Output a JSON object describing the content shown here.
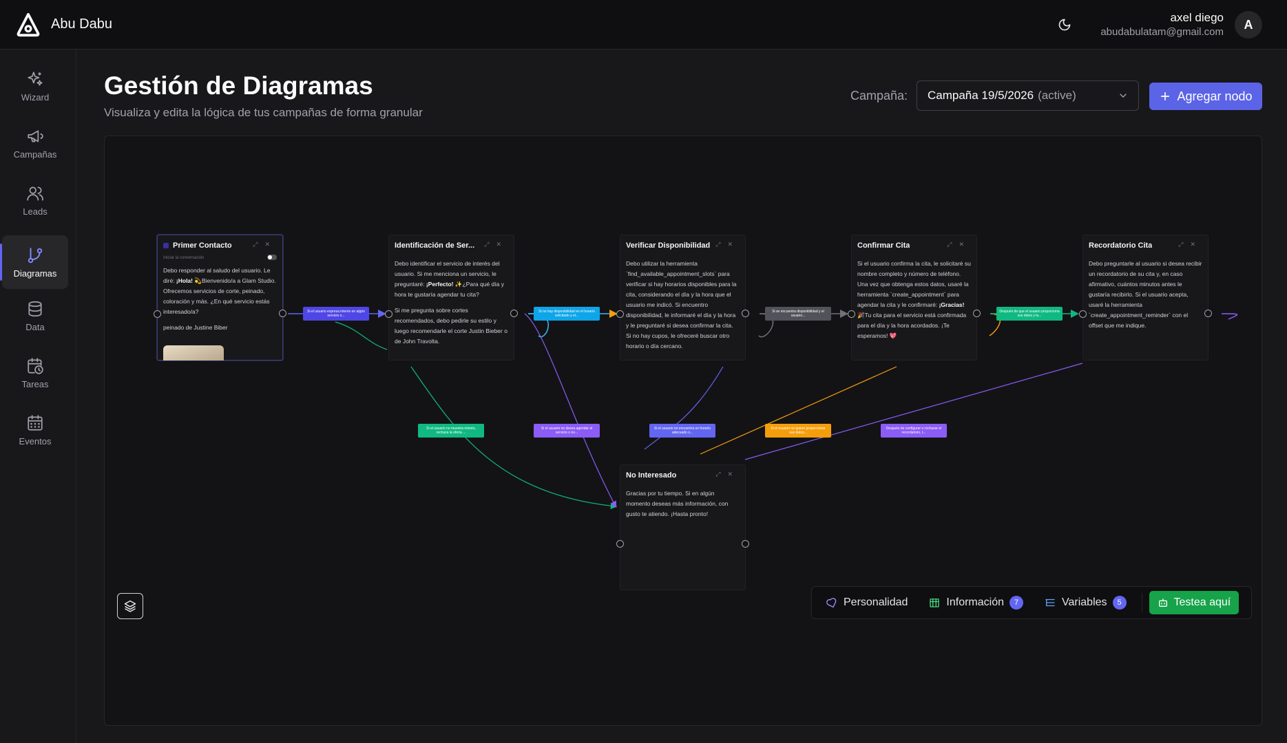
{
  "brand": {
    "name": "Abu Dabu",
    "logo_icon": "abudabu-logo-icon"
  },
  "user": {
    "name": "axel diego",
    "email": "abudabulatam@gmail.com",
    "avatar_initial": "A"
  },
  "nav": {
    "items": [
      {
        "label": "Wizard",
        "icon": "sparkles-icon"
      },
      {
        "label": "Campañas",
        "icon": "megaphone-icon"
      },
      {
        "label": "Leads",
        "icon": "users-icon"
      },
      {
        "label": "Diagramas",
        "icon": "git-branch-icon",
        "active": true
      },
      {
        "label": "Data",
        "icon": "database-icon"
      },
      {
        "label": "Tareas",
        "icon": "calendar-clock-icon"
      },
      {
        "label": "Eventos",
        "icon": "calendar-icon"
      }
    ]
  },
  "page": {
    "title": "Gestión de Diagramas",
    "subtitle": "Visualiza y edita la lógica de tus campañas de forma granular",
    "campaign_label": "Campaña:",
    "campaign_value": "Campaña 19/5/2026",
    "campaign_status": "(active)",
    "add_node_label": "Agregar nodo"
  },
  "nodes": [
    {
      "id": "primer-contacto",
      "title": "Primer Contacto",
      "start_toggle_label": "Iniciar la conversación",
      "body_html_parts": [
        "Debo responder al saludo del usuario. Le diré: ",
        "¡Hola!",
        " 💫Bienvenido/a a Glam Studio. Ofrecemos servicios de corte, peinado, coloración y más. ¿En qué servicio estás interesado/a?"
      ],
      "body_extra": "peinado de Justine Biber"
    },
    {
      "id": "identificacion",
      "title": "Identificación de Ser...",
      "body_html_parts": [
        "Debo identificar el servicio de interés del usuario. Si me menciona un servicio, le preguntaré: ",
        "¡Perfecto!",
        " ✨¿Para qué día y hora te gustaría agendar tu cita?"
      ],
      "body_extra": "Si me pregunta sobre cortes recomendados, debo pedirle su estilo y luego recomendarle el corte Justin Bieber o de John Travolta."
    },
    {
      "id": "verificar",
      "title": "Verificar Disponibilidad",
      "body": "Debo utilizar la herramienta `find_available_appointment_slots` para verificar si hay horarios disponibles para la cita, considerando el día y la hora que el usuario me indicó. Si encuentro disponibilidad, le informaré el día y la hora y le preguntaré si desea confirmar la cita. Si no hay cupos, le ofreceré buscar otro horario o día cercano."
    },
    {
      "id": "confirmar",
      "title": "Confirmar Cita",
      "body_html_parts": [
        "Si el usuario confirma la cita, le solicitaré su nombre completo y número de teléfono. Una vez que obtenga estos datos, usaré la herramienta `create_appointment` para agendar la cita y le confirmaré: ",
        "¡Gracias!",
        " 🎉Tu cita para el servicio está confirmada para el día y la hora acordados. ¡Te esperamos! 💖"
      ]
    },
    {
      "id": "recordatorio",
      "title": "Recordatorio Cita",
      "body": "Debo preguntarle al usuario si desea recibir un recordatorio de su cita y, en caso afirmativo, cuántos minutos antes le gustaría recibirlo. Si el usuario acepta, usaré la herramienta `create_appointment_reminder` con el offset que me indique."
    },
    {
      "id": "no-interesado",
      "title": "No Interesado",
      "body": "Gracias por tu tiempo. Si en algún momento deseas más información, con gusto te atiendo. ¡Hasta pronto!"
    }
  ],
  "edge_labels": [
    {
      "text": "Si el usuario expresa interés en algún servicio o...",
      "color": "#4f46e5"
    },
    {
      "text": "Si no hay disponibilidad en el horario solicitado y el...",
      "color": "#0ea5e9"
    },
    {
      "text": "Si se encuentra disponibilidad y el usuario...",
      "color": "#52525b"
    },
    {
      "text": "Después de que el usuario proporciona sus datos y la...",
      "color": "#10b981"
    },
    {
      "text": "Si el usuario no muestra interés, rechaza la oferta ...",
      "color": "#10b981"
    },
    {
      "text": "Si el usuario no desea agendar el servicio o no...",
      "color": "#8b5cf6"
    },
    {
      "text": "Si el usuario no encuentra un horario adecuado o...",
      "color": "#6366f1"
    },
    {
      "text": "Si el usuario no quiere proporcionar sus datos...",
      "color": "#f59e0b"
    },
    {
      "text": "Después de configurar o rechazar el recordatorio, t...",
      "color": "#8b5cf6"
    }
  ],
  "colors": {
    "accent": "#5b63e6",
    "success": "#16a34a"
  },
  "toolbar": {
    "personalidad": "Personalidad",
    "informacion": "Información",
    "informacion_count": "7",
    "variables": "Variables",
    "variables_count": "5",
    "test_label": "Testea aquí"
  }
}
